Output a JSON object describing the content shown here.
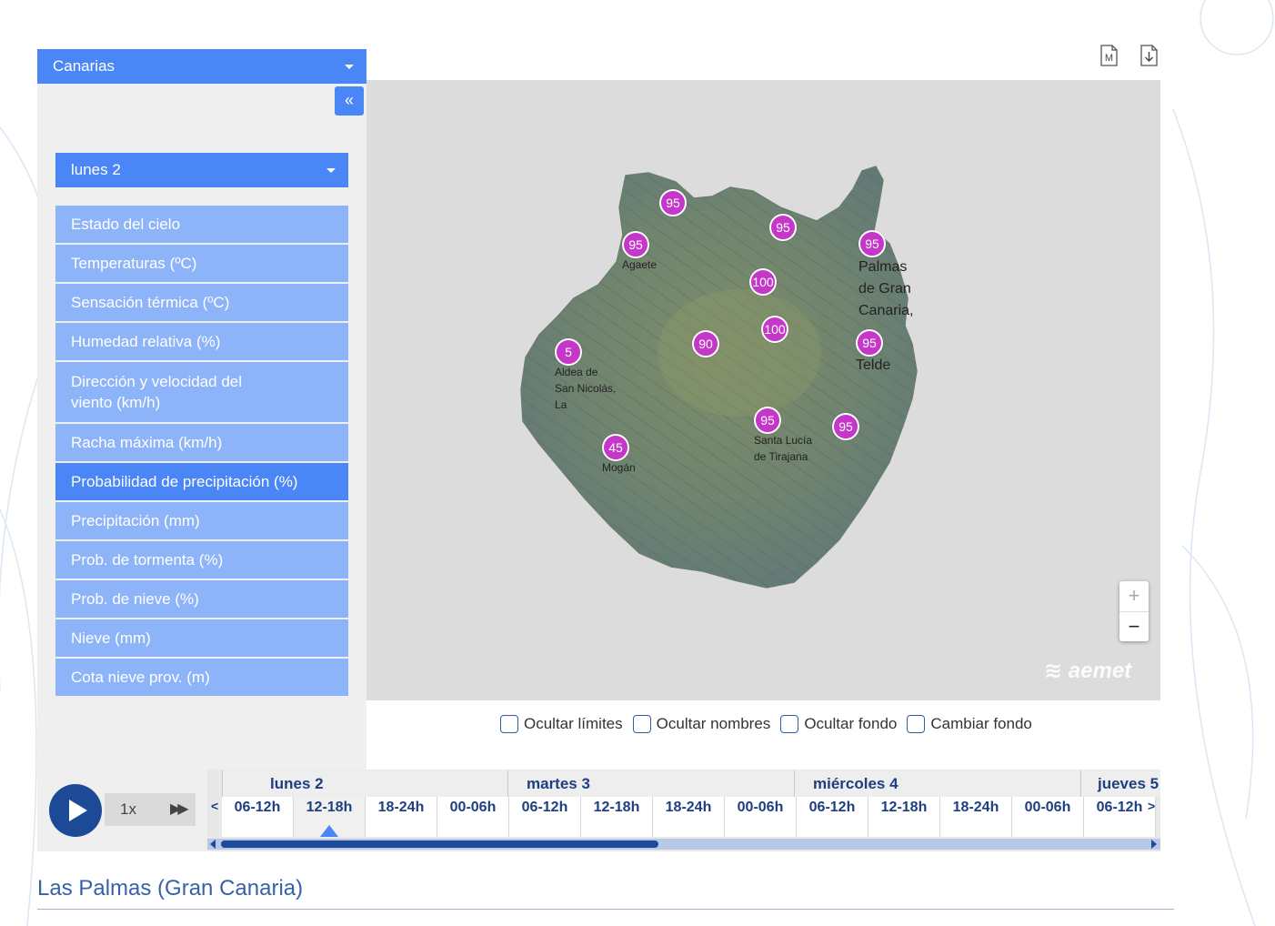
{
  "region_select": {
    "value": "Canarias"
  },
  "sidebar": {
    "collapse_label": "«",
    "day_select": {
      "value": "lunes 2"
    },
    "variables": [
      {
        "label": "Estado del cielo",
        "active": false
      },
      {
        "label": "Temperaturas (ºC)",
        "active": false
      },
      {
        "label": "Sensación térmica (ºC)",
        "active": false
      },
      {
        "label": "Humedad relativa (%)",
        "active": false
      },
      {
        "label_line1": "Dirección y velocidad del",
        "label_line2": "viento (km/h)",
        "active": false
      },
      {
        "label": "Racha máxima (km/h)",
        "active": false
      },
      {
        "label": "Probabilidad de precipitación (%)",
        "active": true
      },
      {
        "label": "Precipitación (mm)",
        "active": false
      },
      {
        "label": "Prob. de tormenta (%)",
        "active": false
      },
      {
        "label": "Prob. de nieve (%)",
        "active": false
      },
      {
        "label": "Nieve (mm)",
        "active": false
      },
      {
        "label": "Cota nieve prov. (m)",
        "active": false
      }
    ]
  },
  "toolbar": {
    "doc_icon_letter": "M"
  },
  "map": {
    "accent_marker_color": "#c437c9",
    "markers": [
      {
        "value": "95"
      },
      {
        "value": "95"
      },
      {
        "value": "95"
      },
      {
        "value": "95"
      },
      {
        "value": "100"
      },
      {
        "value": "100"
      },
      {
        "value": "90"
      },
      {
        "value": "5"
      },
      {
        "value": "95"
      },
      {
        "value": "95"
      },
      {
        "value": "95"
      },
      {
        "value": "45"
      }
    ],
    "places": {
      "agaete": "Agaete",
      "palmas_1": "Palmas",
      "palmas_2": "de Gran",
      "palmas_3": "Canaria,",
      "telde": "Telde",
      "aldea_1": "Aldea de",
      "aldea_2": "San Nicolás,",
      "aldea_3": "La",
      "santa_1": "Santa Lucía",
      "santa_2": "de Tirajana",
      "mogan": "Mogán"
    },
    "zoom_in": "+",
    "zoom_out": "−",
    "logo": "aemet"
  },
  "options": [
    {
      "label": "Ocultar límites",
      "checked": false
    },
    {
      "label": "Ocultar nombres",
      "checked": false
    },
    {
      "label": "Ocultar fondo",
      "checked": false
    },
    {
      "label": "Cambiar fondo",
      "checked": false
    }
  ],
  "player": {
    "speed": "1x",
    "ff": "▶▶"
  },
  "timeline": {
    "days": [
      "lunes 2",
      "martes 3",
      "miércoles 4",
      "jueves 5"
    ],
    "slots": [
      "06-12h",
      "12-18h",
      "18-24h",
      "00-06h",
      "06-12h",
      "12-18h",
      "18-24h",
      "00-06h",
      "06-12h",
      "12-18h",
      "18-24h",
      "00-06h",
      "06-12h"
    ],
    "selected_slot_index": 1,
    "prev": "<",
    "next": ">"
  },
  "station": {
    "title": "Las Palmas (Gran Canaria)"
  },
  "colors": {
    "primary": "#4a86f5",
    "menu_light": "#8db3f9",
    "dark_blue": "#1d4a96"
  }
}
